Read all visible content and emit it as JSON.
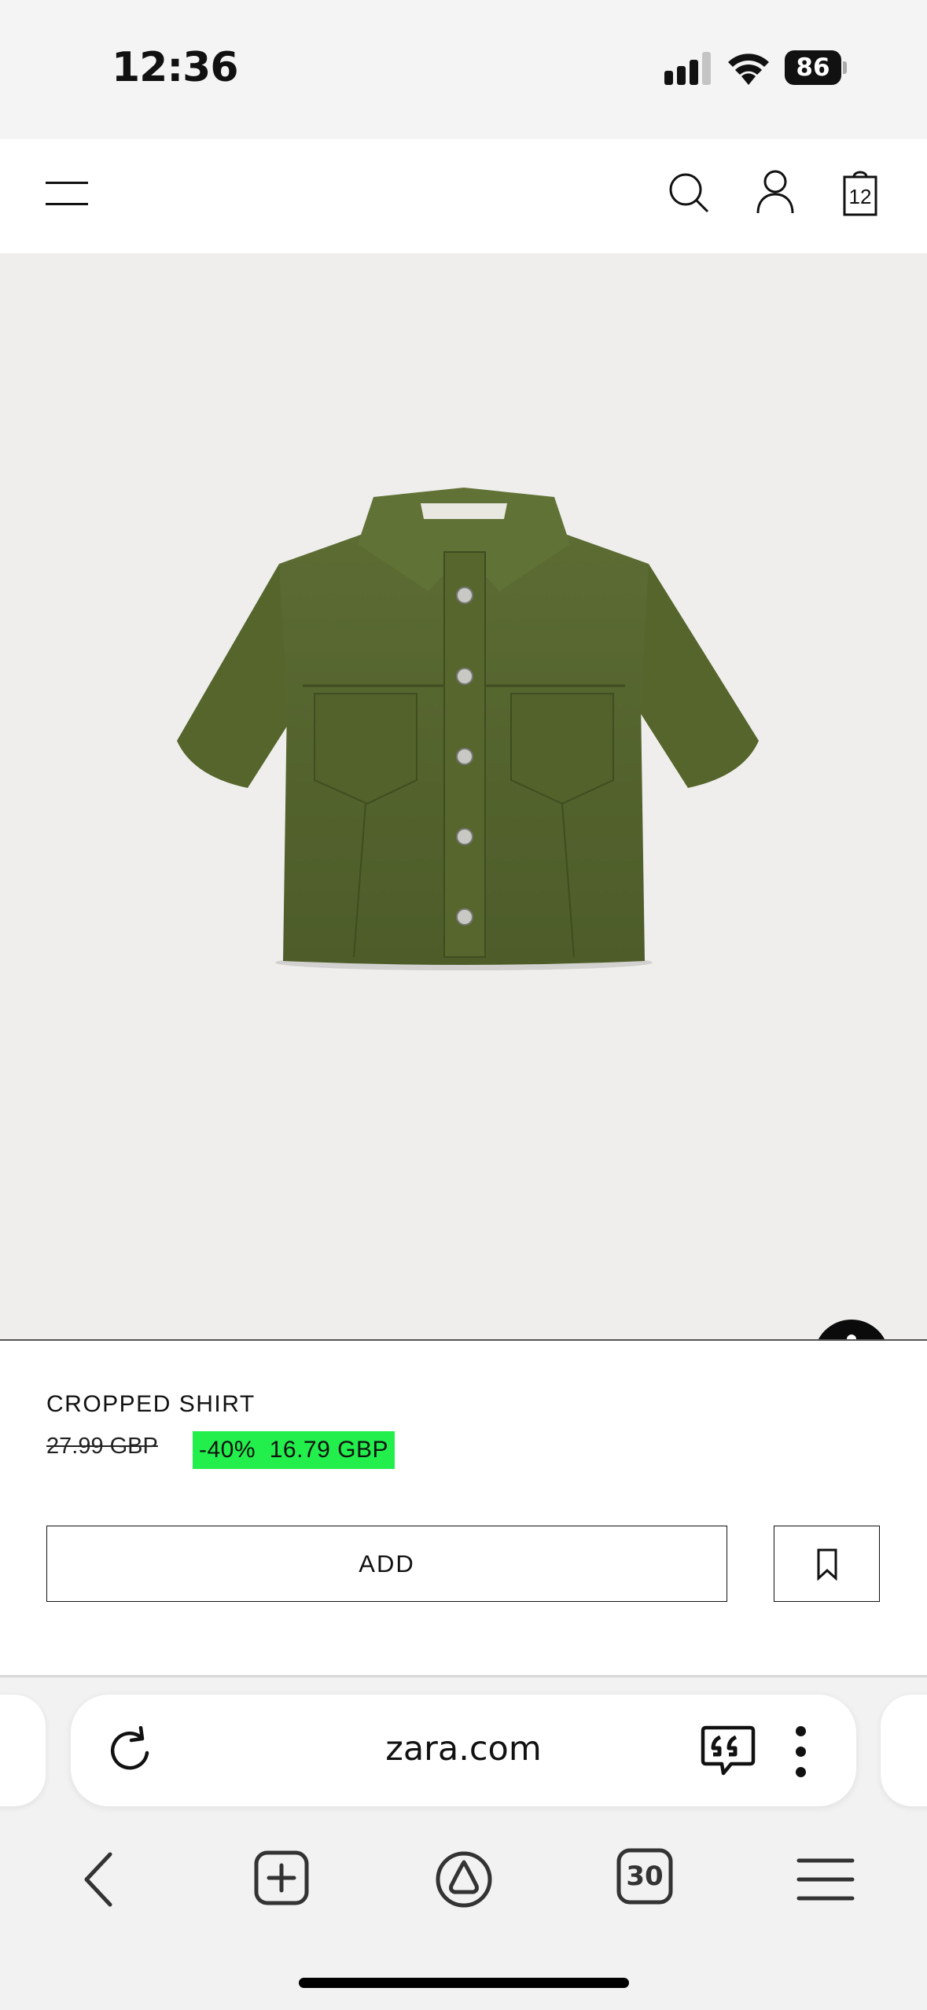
{
  "status_bar": {
    "time": "12:36",
    "battery": "86",
    "icons": [
      "signal-icon",
      "wifi-icon",
      "battery-icon"
    ]
  },
  "header": {
    "icons": [
      "menu-icon",
      "search-icon",
      "account-icon",
      "shopping-bag-icon"
    ],
    "bag_count": "12"
  },
  "product": {
    "image": "green-cropped-shirt-image",
    "name": "CROPPED SHIRT",
    "old_price": "27.99 GBP",
    "discount": "-40%",
    "new_price": "16.79 GBP",
    "add_label": "ADD",
    "shirt_color": "#56662e",
    "badge_color": "#22ef4c"
  },
  "browser": {
    "url": "zara.com",
    "tab_count": "30",
    "icons": [
      "reload-icon",
      "quote-icon",
      "more-icon",
      "back-icon",
      "new-tab-icon",
      "assistant-icon",
      "tabs-icon",
      "menu-icon"
    ]
  }
}
